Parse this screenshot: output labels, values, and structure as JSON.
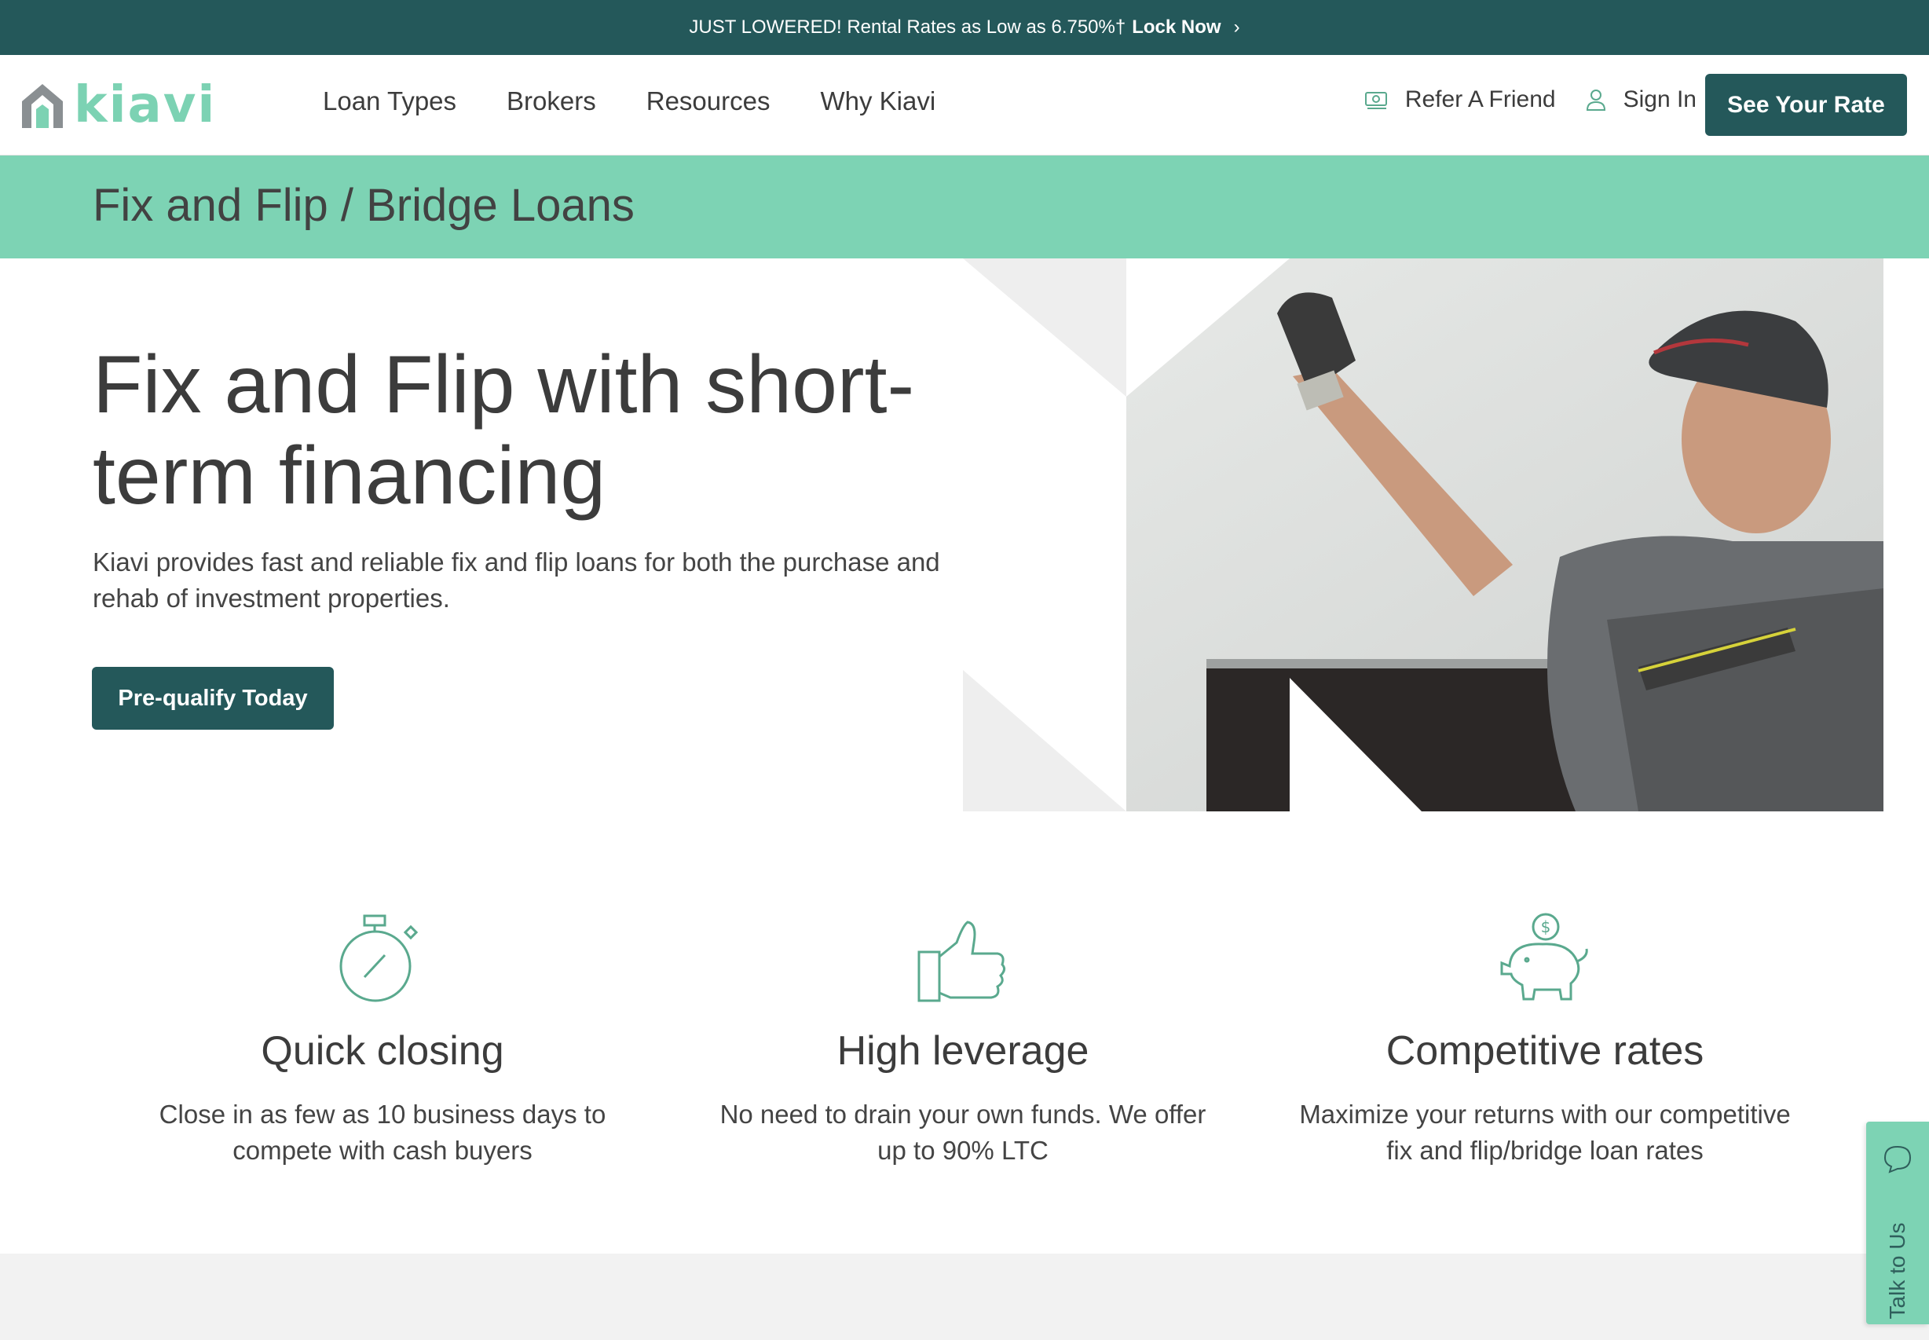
{
  "announcement": {
    "text": "JUST LOWERED! Rental Rates as Low as 6.750%†",
    "link": "Lock Now",
    "chevron": "›"
  },
  "header": {
    "logo_text": "kiavi",
    "nav": [
      "Loan Types",
      "Brokers",
      "Resources",
      "Why Kiavi"
    ],
    "refer": "Refer A Friend",
    "sign_in": "Sign In",
    "cta": "See Your Rate"
  },
  "band": {
    "title": "Fix and Flip / Bridge Loans"
  },
  "hero": {
    "title": "Fix and Flip with short-term financing",
    "subtitle": "Kiavi provides fast and reliable fix and flip loans for both the purchase and rehab of investment properties.",
    "cta": "Pre-qualify Today"
  },
  "features": [
    {
      "icon": "stopwatch-icon",
      "title": "Quick closing",
      "text": "Close in as few as 10 business days to compete with cash buyers"
    },
    {
      "icon": "thumbs-up-icon",
      "title": "High leverage",
      "text": "No need to drain your own funds. We offer up to 90% LTC"
    },
    {
      "icon": "piggy-bank-icon",
      "title": "Competitive rates",
      "text": "Maximize your returns with our competitive fix and flip/bridge loan rates"
    }
  ],
  "talk": {
    "label": "Talk to Us"
  },
  "colors": {
    "primary": "#24585a",
    "accent": "#7dd3b4",
    "icon": "#5aa98e"
  }
}
